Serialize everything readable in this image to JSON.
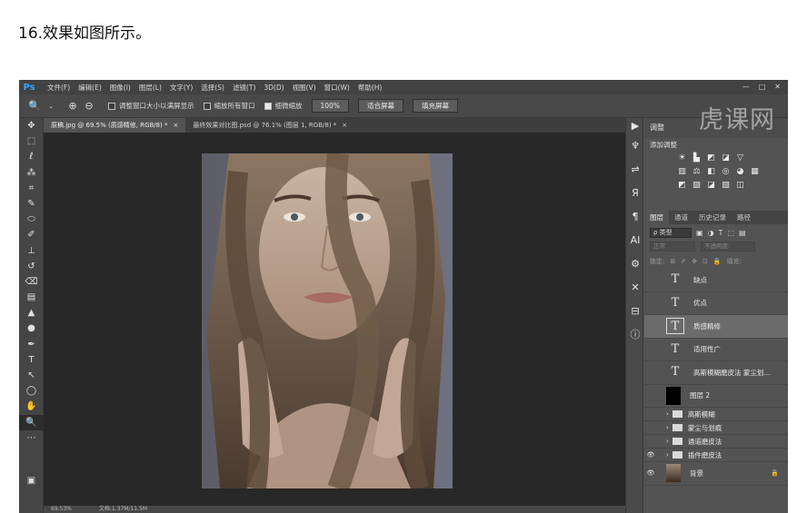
{
  "page": {
    "heading": "16.效果如图所示。"
  },
  "app": {
    "logo": "Ps",
    "menu": [
      "文件(F)",
      "编辑(E)",
      "图像(I)",
      "图层(L)",
      "文字(Y)",
      "选择(S)",
      "滤镜(T)",
      "3D(D)",
      "视图(V)",
      "窗口(W)",
      "帮助(H)"
    ],
    "watermark": "虎课网"
  },
  "options_bar": {
    "resize_windows": "调整窗口大小以满屏显示",
    "zoom_all_windows": "缩放所有窗口",
    "scrubby_zoom": "细微缩放",
    "zoom_percent": "100%",
    "fit_screen": "适合屏幕",
    "fill_screen": "填充屏幕"
  },
  "tabs": [
    {
      "label": "原稿.jpg @ 69.5% (质感精修, RGB/8) *"
    },
    {
      "label": "最终效果对比图.psd @ 76.1% (图层 1, RGB/8) *"
    }
  ],
  "status": {
    "zoom": "69.53%",
    "doc": "文档:1.37M/11.5M"
  },
  "adjustments": {
    "title": "调整",
    "subtitle": "添加调整"
  },
  "layers_panel": {
    "tabs": [
      "图层",
      "通道",
      "历史记录",
      "路径"
    ],
    "kind": "ρ 类型",
    "blend_mode": "正常",
    "opacity": "不透明度:",
    "lock_label": "锁定:",
    "fill_label": "填充:",
    "layers": [
      {
        "type": "text",
        "name": "缺点"
      },
      {
        "type": "text",
        "name": "优点"
      },
      {
        "type": "text",
        "name": "质感精修",
        "selected": true
      },
      {
        "type": "text",
        "name": "适用性广"
      },
      {
        "type": "text",
        "name": "高斯模糊磨皮法 蒙尘划..."
      },
      {
        "type": "black",
        "name": "图层 2"
      },
      {
        "type": "group",
        "name": "高斯模糊"
      },
      {
        "type": "group",
        "name": "蒙尘与划痕"
      },
      {
        "type": "group",
        "name": "通道磨皮法"
      },
      {
        "type": "group",
        "name": "插件磨皮法"
      },
      {
        "type": "photo",
        "name": "背景"
      }
    ]
  },
  "colors": {
    "ps_bg": "#535353",
    "canvas_bg": "#282828",
    "selection": "#6b6b6b",
    "ps_blue": "#31a8ff"
  }
}
